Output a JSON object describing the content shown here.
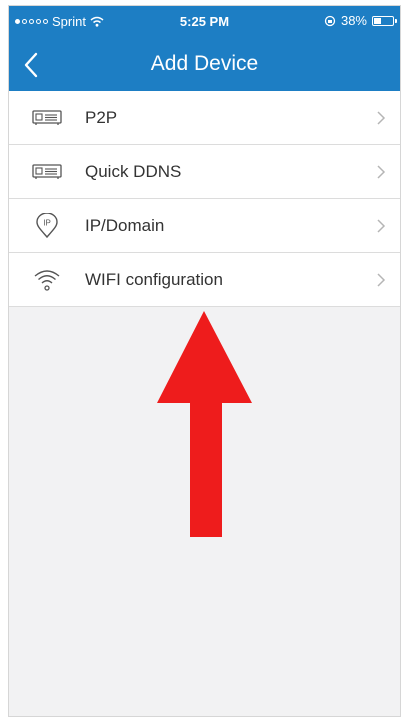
{
  "status_bar": {
    "carrier": "Sprint",
    "signal_dots_filled": 1,
    "signal_dots_total": 5,
    "time": "5:25 PM",
    "battery_text": "38%",
    "battery_level": 0.38
  },
  "nav": {
    "title": "Add Device",
    "back_icon": "chevron-left-icon"
  },
  "menu": {
    "items": [
      {
        "label": "P2P",
        "icon": "device-box-icon"
      },
      {
        "label": "Quick DDNS",
        "icon": "device-box-icon"
      },
      {
        "label": "IP/Domain",
        "icon": "ip-pin-icon",
        "icon_text": "IP"
      },
      {
        "label": "WIFI configuration",
        "icon": "wifi-icon"
      }
    ]
  },
  "colors": {
    "header": "#1d7ec4",
    "annotation_arrow": "#ee1c1c",
    "background": "#f2f2f3"
  }
}
